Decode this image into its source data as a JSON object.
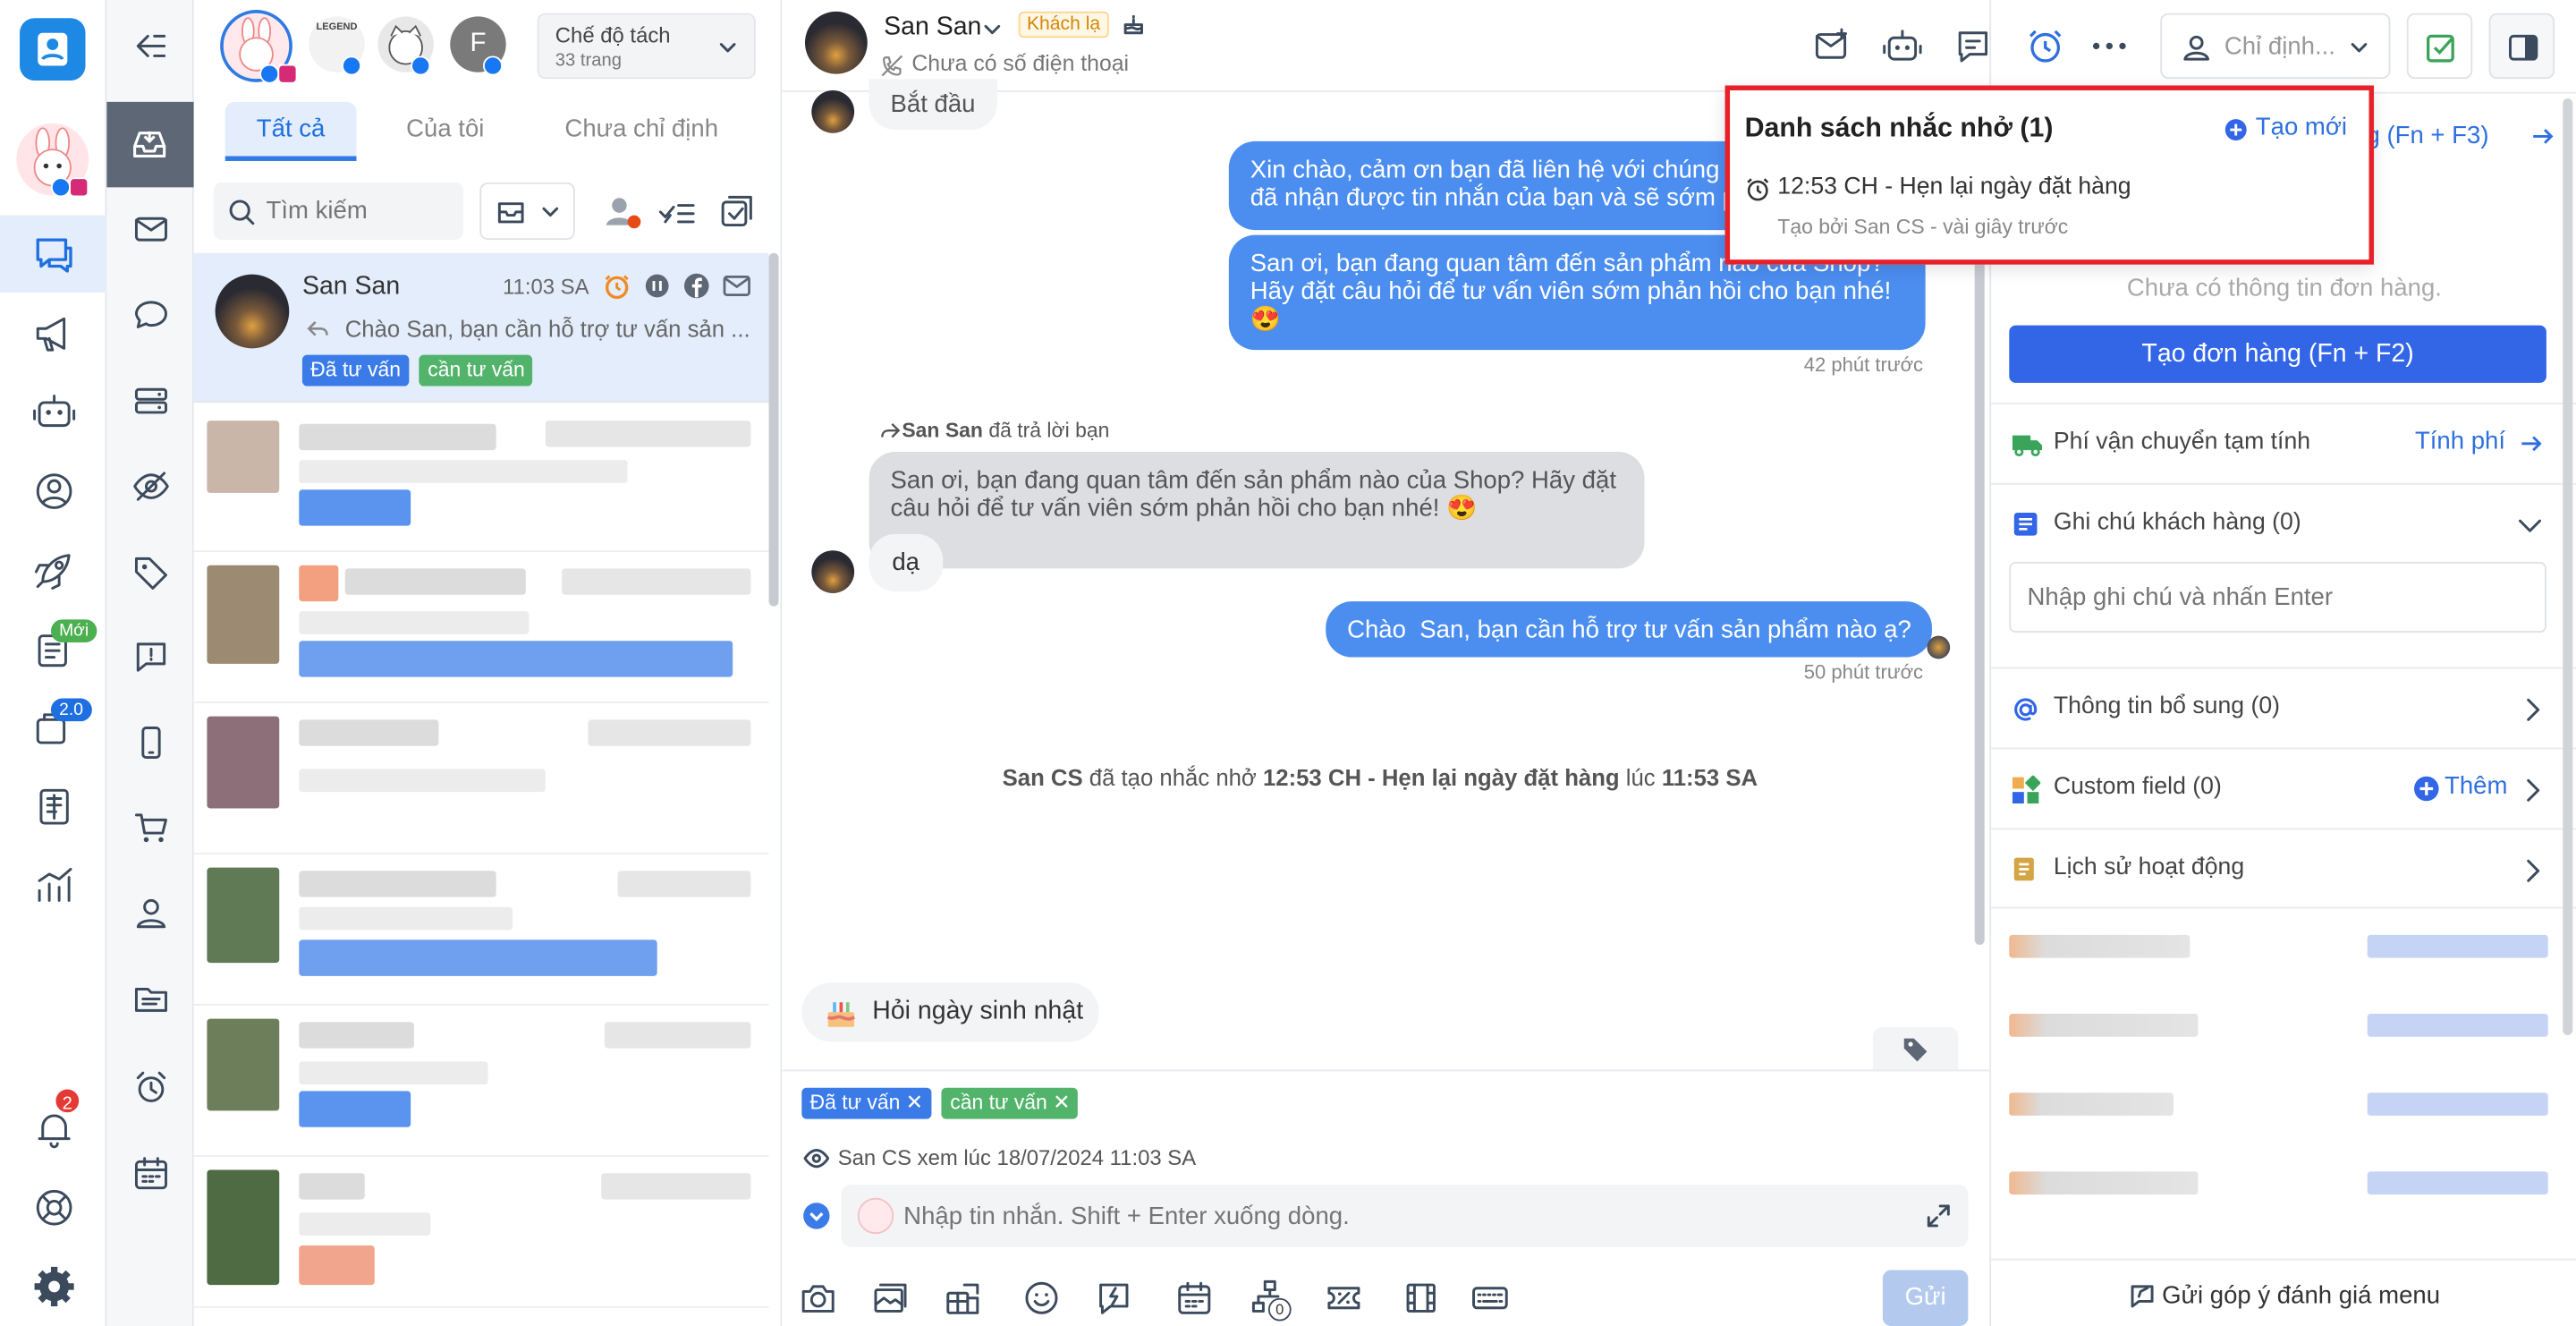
{
  "nav": {
    "new_badge": "Mới",
    "v2_badge": "2.0",
    "notif_count": "2"
  },
  "pages": {
    "mode_label": "Chế độ tách",
    "mode_count": "33 trang",
    "page_initial": "F",
    "legend_label": "LEGEND"
  },
  "tabs": {
    "all": "Tất cả",
    "mine": "Của tôi",
    "unassigned": "Chưa chỉ định"
  },
  "search": {
    "placeholder": "Tìm kiếm"
  },
  "active_conv": {
    "name": "San San",
    "time": "11:03 SA",
    "preview": "Chào San, bạn cần hỗ trợ tư vấn sản ...",
    "tags": [
      "Đã tư vấn",
      "cần tư vấn"
    ]
  },
  "header": {
    "name": "San San",
    "badge": "Khách lạ",
    "phone": "Chưa có số điện thoại",
    "assign": "Chỉ định..."
  },
  "messages": {
    "start": "Bắt đầu",
    "m1": "Xin chào, cảm ơn bạn đã liên hệ với chúng tôi. Chúng tôi đã nhận được tin nhắn của bạn và sẽ sớm phản hồi",
    "m2": "San ơi, bạn đang quan tâm đến sản phẩm nào của Shop? Hãy đặt câu hỏi để tư vấn viên sớm phản hồi cho bạn nhé! 😍",
    "t1": "42 phút trước",
    "reply_name": "San San",
    "reply_text": "đã trả lời bạn",
    "quoted": "San ơi, bạn đang quan tâm đến sản phẩm nào của Shop? Hãy đặt câu hỏi để tư vấn viên sớm phản hồi cho bạn nhé! 😍",
    "da": "dạ",
    "m3": "Chào  San, bạn cần hỗ trợ tư vấn sản phẩm nào ạ?",
    "t2": "50 phút trước",
    "sys_agent": "San CS",
    "sys_mid": "đã tạo nhắc nhở",
    "sys_bold": "12:53 CH - Hẹn lại ngày đặt hàng",
    "sys_at": "lúc",
    "sys_time": "11:53 SA"
  },
  "birthday": "Hỏi ngày sinh nhật",
  "chat_tags": [
    "Đã tư vấn",
    "cần tư vấn"
  ],
  "seen": "San CS xem lúc 18/07/2024 11:03 SA",
  "composer": {
    "placeholder": "Nhập tin nhắn. Shift + Enter xuống dòng.",
    "send": "Gửi",
    "counter": "0"
  },
  "reminder": {
    "title": "Danh sách nhắc nhở (1)",
    "create": "Tạo mới",
    "item": "12:53 CH - Hẹn lại ngày đặt hàng",
    "by": "Tạo bởi San CS - vài giây trước"
  },
  "right": {
    "order_link": "ng (Fn + F3)",
    "no_order": "Chưa có thông tin đơn hàng.",
    "create_order": "Tạo đơn hàng (Fn + F2)",
    "shipping": "Phí vận chuyển tạm tính",
    "calc": "Tính phí",
    "notes": "Ghi chú khách hàng (0)",
    "note_placeholder": "Nhập ghi chú và nhấn Enter",
    "extra": "Thông tin bổ sung (0)",
    "custom": "Custom field (0)",
    "add": "Thêm",
    "history": "Lịch sử hoạt động",
    "feedback": "Gửi góp ý đánh giá menu"
  },
  "colors": {
    "accent": "#3266e6",
    "bubble": "#4c8ef0",
    "tag_blue": "#3a7be8",
    "tag_green": "#52b36b",
    "alert_red": "#e8202a"
  }
}
